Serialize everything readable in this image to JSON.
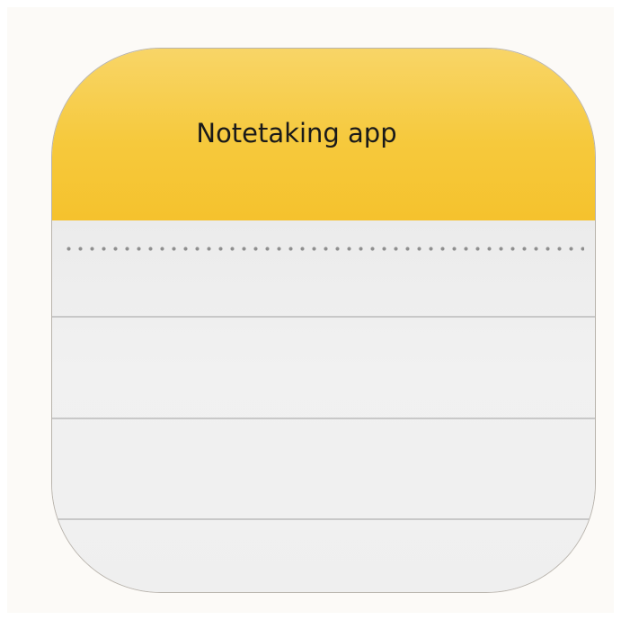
{
  "icon": {
    "title": "Notetaking app",
    "header_color": "#f6c93c",
    "paper_color": "#efefef",
    "line_color": "#c8c8c8"
  }
}
